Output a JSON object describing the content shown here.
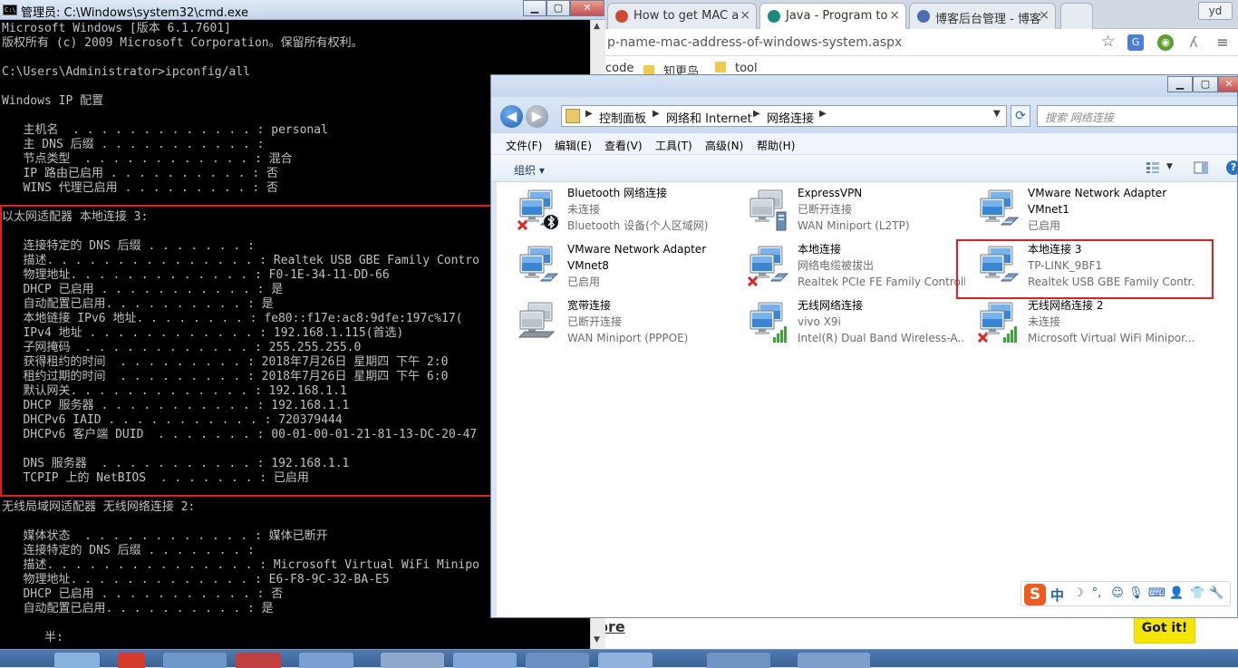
{
  "browser": {
    "tabs": [
      {
        "label": "How to get MAC a",
        "icon_color": "#d04a33"
      },
      {
        "label": "Java - Program to",
        "icon_color": "#1c8a7e"
      },
      {
        "label": "博客后台管理 - 博客",
        "icon_color": "#4a6fb0"
      }
    ],
    "user_badge": "yd",
    "url_text": "p-name-mac-address-of-windows-system.aspx",
    "bookmarks": [
      "code",
      "知更鸟",
      "tool"
    ],
    "more_link": "ore",
    "got_it_label": "Got it!"
  },
  "cmd": {
    "title": "管理员: C:\\Windows\\system32\\cmd.exe",
    "icon_text": "C:\\",
    "lines": [
      "Microsoft Windows [版本 6.1.7601]",
      "版权所有 (c) 2009 Microsoft Corporation。保留所有权利。",
      "",
      "C:\\Users\\Administrator>ipconfig/all",
      "",
      "Windows IP 配置",
      "",
      "   主机名  . . . . . . . . . . . . . : personal",
      "   主 DNS 后缀 . . . . . . . . . . . :",
      "   节点类型  . . . . . . . . . . . . : 混合",
      "   IP 路由已启用 . . . . . . . . . . : 否",
      "   WINS 代理已启用 . . . . . . . . . : 否",
      "",
      "以太网适配器 本地连接 3:",
      "",
      "   连接特定的 DNS 后缀 . . . . . . . :",
      "   描述. . . . . . . . . . . . . . . : Realtek USB GBE Family Contro",
      "   物理地址. . . . . . . . . . . . . : F0-1E-34-11-DD-66",
      "   DHCP 已启用 . . . . . . . . . . . : 是",
      "   自动配置已启用. . . . . . . . . . : 是",
      "   本地链接 IPv6 地址. . . . . . . . : fe80::f17e:ac8:9dfe:197c%17(",
      "   IPv4 地址 . . . . . . . . . . . . : 192.168.1.115(首选)",
      "   子网掩码  . . . . . . . . . . . . : 255.255.255.0",
      "   获得租约的时间  . . . . . . . . . : 2018年7月26日 星期四 下午 2:0",
      "   租约过期的时间  . . . . . . . . . : 2018年7月26日 星期四 下午 6:0",
      "   默认网关. . . . . . . . . . . . . : 192.168.1.1",
      "   DHCP 服务器 . . . . . . . . . . . : 192.168.1.1",
      "   DHCPv6 IAID . . . . . . . . . . . : 720379444",
      "   DHCPv6 客户端 DUID  . . . . . . . : 00-01-00-01-21-81-13-DC-20-47",
      "",
      "   DNS 服务器  . . . . . . . . . . . : 192.168.1.1",
      "   TCPIP 上的 NetBIOS  . . . . . . . : 已启用",
      "",
      "无线局域网适配器 无线网络连接 2:",
      "",
      "   媒体状态  . . . . . . . . . . . . : 媒体已断开",
      "   连接特定的 DNS 后缀 . . . . . . . :",
      "   描述. . . . . . . . . . . . . . . : Microsoft Virtual WiFi Minipo",
      "   物理地址. . . . . . . . . . . . . : E6-F8-9C-32-BA-E5",
      "   DHCP 已启用 . . . . . . . . . . . : 否",
      "   自动配置已启用. . . . . . . . . . : 是",
      "",
      "      半:"
    ]
  },
  "explorer": {
    "breadcrumb": [
      "控制面板",
      "网络和 Internet",
      "网络连接"
    ],
    "search_placeholder": "搜索 网络连接",
    "menu": [
      "文件(F)",
      "编辑(E)",
      "查看(V)",
      "工具(T)",
      "高级(N)",
      "帮助(H)"
    ],
    "organize_label": "组织 ▾",
    "help_label": "?",
    "connections": [
      {
        "name": "Bluetooth 网络连接",
        "line2": "",
        "status": "未连接",
        "device": "Bluetooth 设备(个人区域网)",
        "icon": "bluetooth-network-icon",
        "badge": "disconnected"
      },
      {
        "name": "ExpressVPN",
        "line2": "",
        "status": "已断开连接",
        "device": "WAN Miniport (L2TP)",
        "icon": "vpn-network-icon",
        "badge": "none"
      },
      {
        "name": "VMware Network Adapter",
        "line2": "VMnet1",
        "status": "已启用",
        "device": "",
        "icon": "ethernet-network-icon",
        "badge": "none"
      },
      {
        "name": "VMware Network Adapter",
        "line2": "VMnet8",
        "status": "已启用",
        "device": "",
        "icon": "ethernet-network-icon",
        "badge": "none"
      },
      {
        "name": "本地连接",
        "line2": "",
        "status": "网络电缆被拔出",
        "device": "Realtek PCIe FE Family Controll...",
        "icon": "ethernet-network-icon",
        "badge": "disconnected"
      },
      {
        "name": "本地连接 3",
        "line2": "",
        "status": "TP-LINK_9BF1",
        "device": "Realtek USB GBE Family Contr...",
        "icon": "ethernet-network-icon",
        "badge": "none"
      },
      {
        "name": "宽带连接",
        "line2": "",
        "status": "已断开连接",
        "device": "WAN Miniport (PPPOE)",
        "icon": "broadband-network-icon",
        "badge": "none"
      },
      {
        "name": "无线网络连接",
        "line2": "",
        "status": "vivo X9i",
        "device": "Intel(R) Dual Band Wireless-A...",
        "icon": "wireless-network-icon",
        "badge": "signal"
      },
      {
        "name": "无线网络连接 2",
        "line2": "",
        "status": "未连接",
        "device": "Microsoft Virtual WiFi Minipor...",
        "icon": "wireless-network-icon",
        "badge": "disconnected"
      }
    ]
  },
  "ime": {
    "logo": "S",
    "mode": "中"
  },
  "colors": {
    "highlight": "#e02020",
    "cmd_bg": "#000000",
    "cmd_text": "#c0c0c0",
    "got_it": "#f3e600"
  }
}
